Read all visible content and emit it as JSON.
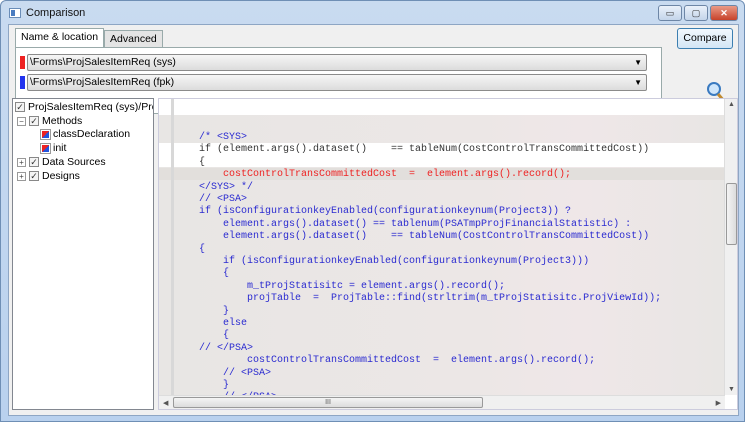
{
  "window": {
    "title": "Comparison",
    "minimize": "▭",
    "maximize": "▢",
    "close": "✕"
  },
  "tabs": [
    {
      "label": "Name & location"
    },
    {
      "label": "Advanced"
    }
  ],
  "selectors": [
    {
      "value": "\\Forms\\ProjSalesItemReq (sys)",
      "color": "#ee2222"
    },
    {
      "value": "\\Forms\\ProjSalesItemReq (fpk)",
      "color": "#2233ee"
    }
  ],
  "compare_label": "Compare",
  "tree": {
    "root": "ProjSalesItemReq (sys)/ProjSalesItemReq (fpk)",
    "methods": "Methods",
    "classDeclaration": "classDeclaration",
    "init": "init",
    "datasources": "Data Sources",
    "designs": "Designs"
  },
  "code": [
    {
      "text": "/* <SYS>",
      "color": "#2a2ad0"
    },
    {
      "text": "if (element.args().dataset()    == tableNum(CostControlTransCommittedCost))",
      "color": "#333333"
    },
    {
      "text": "{",
      "color": "#333333"
    },
    {
      "text": "    costControlTransCommittedCost  =  element.args().record();",
      "color": "#ee2222"
    },
    {
      "text": "</SYS> */",
      "color": "#2a2ad0"
    },
    {
      "text": "// <PSA>",
      "color": "#2a2ad0"
    },
    {
      "text": "if (isConfigurationkeyEnabled(configurationkeynum(Project3)) ?",
      "color": "#2a2ad0"
    },
    {
      "text": "    element.args().dataset() == tablenum(PSATmpProjFinancialStatistic) :",
      "color": "#2a2ad0"
    },
    {
      "text": "    element.args().dataset()    == tableNum(CostControlTransCommittedCost))",
      "color": "#2a2ad0"
    },
    {
      "text": "{",
      "color": "#2a2ad0"
    },
    {
      "text": "    if (isConfigurationkeyEnabled(configurationkeynum(Project3)))",
      "color": "#2a2ad0"
    },
    {
      "text": "    {",
      "color": "#2a2ad0"
    },
    {
      "text": "        m_tProjStatisitc = element.args().record();",
      "color": "#2a2ad0"
    },
    {
      "text": "        projTable  =  ProjTable::find(strltrim(m_tProjStatisitc.ProjViewId));",
      "color": "#2a2ad0"
    },
    {
      "text": "    }",
      "color": "#2a2ad0"
    },
    {
      "text": "    else",
      "color": "#2a2ad0"
    },
    {
      "text": "    {",
      "color": "#2a2ad0"
    },
    {
      "text": "// </PSA>",
      "color": "#2a2ad0"
    },
    {
      "text": "        costControlTransCommittedCost  =  element.args().record();",
      "color": "#2a2ad0"
    },
    {
      "text": "    // <PSA>",
      "color": "#2a2ad0"
    },
    {
      "text": "    }",
      "color": "#2a2ad0"
    },
    {
      "text": "    // </PSA>",
      "color": "#2a2ad0"
    }
  ],
  "scroll": {
    "grip": "III"
  }
}
